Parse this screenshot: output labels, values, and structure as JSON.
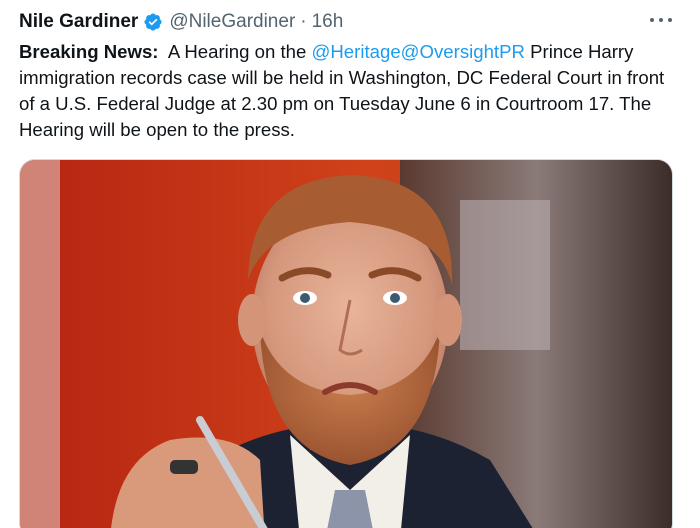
{
  "tweet": {
    "author_name": "Nile Gardiner",
    "handle": "@NileGardiner",
    "separator": "·",
    "time": "16h",
    "body": {
      "lead": "Breaking News:",
      "part1": "A Hearing on the ",
      "mention1": "@Heritage",
      "mention2": "@OversightPR",
      "part2": " Prince Harry immigration records case will be held in Washington, DC Federal Court in front of a U.S. Federal Judge at 2.30 pm on Tuesday June 6 in Courtroom 17. The Hearing will be open to the press."
    },
    "media_description": "photo-man-with-red-beard"
  },
  "colors": {
    "text": "#0f1419",
    "secondary": "#536471",
    "link": "#1d9bf0",
    "verified": "#1d9bf0"
  }
}
